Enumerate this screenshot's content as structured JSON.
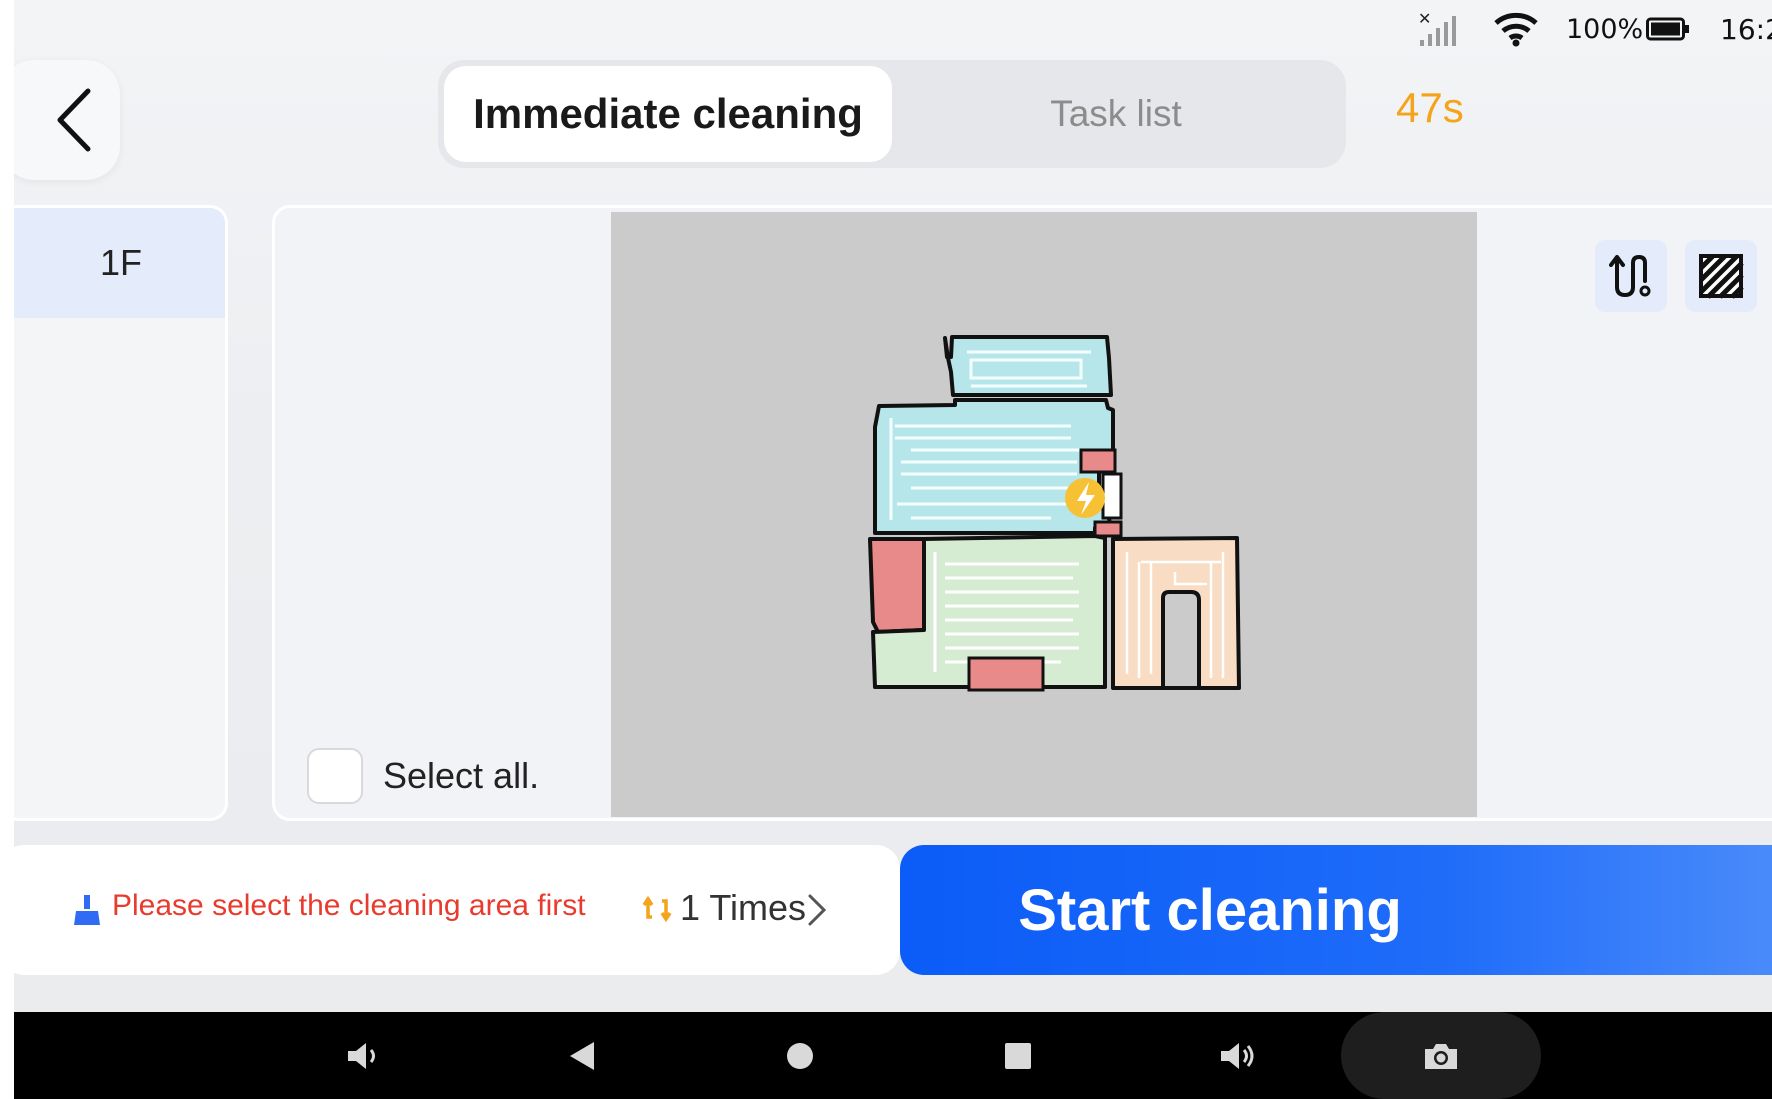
{
  "status_bar": {
    "battery_percent": "100%",
    "time": "16:2",
    "icons": [
      "no-signal-icon",
      "wifi-icon",
      "battery-icon"
    ]
  },
  "header": {
    "back_icon": "chevron-left-icon",
    "tabs": [
      {
        "label": "Immediate cleaning",
        "active": true
      },
      {
        "label": "Task list",
        "active": false
      }
    ],
    "timer": "47s"
  },
  "floors": [
    {
      "label": "1F",
      "selected": true
    }
  ],
  "map": {
    "select_all_label": "Select all.",
    "select_all_checked": false,
    "tools": [
      "route-icon",
      "hatch-icon"
    ],
    "charging_dock_icon": "lightning-icon",
    "room_colors": {
      "cyan": "#b6e5ea",
      "green": "#d6ecd2",
      "peach": "#f8dcc3",
      "red": "#e88a8a"
    }
  },
  "action_bar": {
    "hint": "Please select the cleaning area first",
    "hint_icon": "broom-icon",
    "times_icon": "repeat-icon",
    "times": "1 Times",
    "start_label": "Start cleaning"
  },
  "colors": {
    "accent": "#0b5cf8",
    "timer": "#f4a41a",
    "warning": "#e83b2e"
  },
  "nav_bar": {
    "buttons": [
      "volume-down-icon",
      "back-triangle-icon",
      "home-circle-icon",
      "recents-square-icon",
      "volume-up-icon",
      "camera-icon"
    ]
  }
}
